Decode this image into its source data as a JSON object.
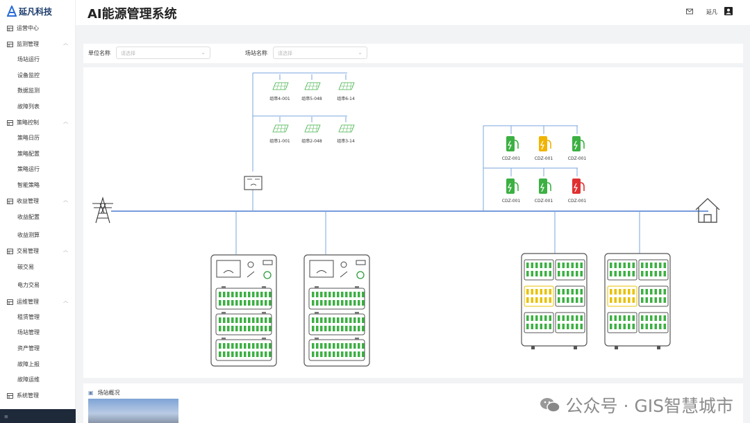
{
  "brand": {
    "name": "延凡科技"
  },
  "header": {
    "title": "AI能源管理系统",
    "user": "延凡"
  },
  "sidebar": {
    "groups": [
      {
        "label": "运营中心",
        "icon": "dashboard-icon"
      },
      {
        "label": "监测管理",
        "icon": "monitor-icon",
        "items": [
          "场站运行",
          "设备监控",
          "数据监测",
          "故障列表"
        ]
      },
      {
        "label": "策略控制",
        "icon": "strategy-icon",
        "items": [
          "策略日历",
          "策略配置",
          "策略运行",
          "智能策略"
        ]
      },
      {
        "label": "收益管理",
        "icon": "revenue-icon",
        "items": [
          "收益配置",
          "收益测算"
        ]
      },
      {
        "label": "交易管理",
        "icon": "trade-icon",
        "items": [
          "碳交易",
          "电力交易"
        ]
      },
      {
        "label": "运维管理",
        "icon": "ops-icon",
        "items": [
          "租赁管理",
          "场站管理",
          "资产管理",
          "故障上报",
          "故障运维"
        ]
      },
      {
        "label": "系统管理",
        "icon": "system-icon"
      }
    ]
  },
  "filters": {
    "unit_label": "单位名称",
    "unit_placeholder": "请选择",
    "station_label": "场站名称",
    "station_placeholder": "请选择"
  },
  "solar": {
    "top": [
      "组串4-001",
      "组串5-048",
      "组串6-14"
    ],
    "bottom": [
      "组串1-001",
      "组串2-048",
      "组串3-14"
    ]
  },
  "chargers": {
    "top": [
      {
        "label": "CDZ-001",
        "status": "green"
      },
      {
        "label": "CDZ-001",
        "status": "yellow"
      },
      {
        "label": "CDZ-001",
        "status": "green"
      }
    ],
    "bottom": [
      {
        "label": "CDZ-001",
        "status": "green"
      },
      {
        "label": "CDZ-001",
        "status": "green"
      },
      {
        "label": "CDZ-001",
        "status": "red"
      }
    ]
  },
  "colors": {
    "green": "#3cb043",
    "yellow": "#f0b400",
    "red": "#e03030",
    "line": "#4a7bd0",
    "cell_yellow": "#e8c200"
  },
  "overview": {
    "title": "场站概况"
  },
  "watermark": "公众号 · GIS智慧城市"
}
